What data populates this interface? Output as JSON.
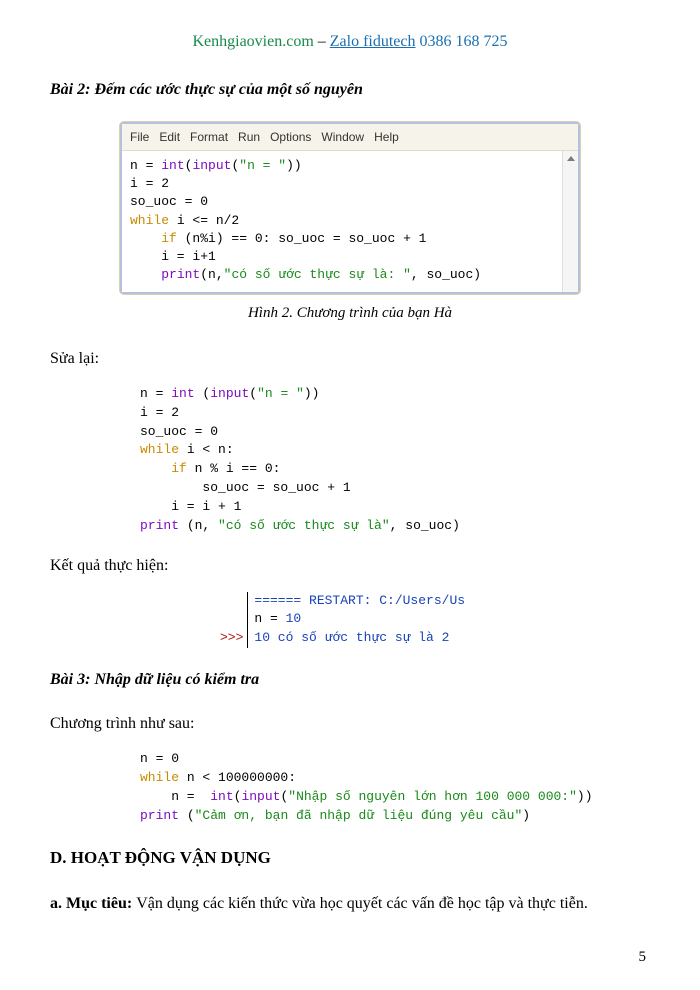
{
  "header": {
    "site": "Kenhgiaovien.com",
    "dash": " – ",
    "zalo": "Zalo fidutech",
    "phone": " 0386 168 725"
  },
  "bai2_title": "Bài 2: Đếm các ước thực sự của một số nguyên",
  "menubar": [
    "File",
    "Edit",
    "Format",
    "Run",
    "Options",
    "Window",
    "Help"
  ],
  "code1": {
    "l1a": "n = ",
    "l1b": "int",
    "l1c": "(",
    "l1d": "input",
    "l1e": "(",
    "l1f": "\"n = \"",
    "l1g": "))",
    "l2": "i = 2",
    "l3": "so_uoc = 0",
    "l4a": "while",
    "l4b": " i <= n/2",
    "l5a": "    ",
    "l5b": "if",
    "l5c": " (n%i) == 0: so_uoc = so_uoc + 1",
    "l6": "    i = i+1",
    "l7a": "    ",
    "l7b": "print",
    "l7c": "(n,",
    "l7d": "\"có số ước thực sự là: \"",
    "l7e": ", so_uoc)"
  },
  "caption2": "Hình 2. Chương trình của bạn Hà",
  "sua_lai": "Sửa lại:",
  "code2": {
    "l1a": "n = ",
    "l1b": "int",
    "l1c": " (",
    "l1d": "input",
    "l1e": "(",
    "l1f": "\"n = \"",
    "l1g": "))",
    "l2": "i = 2",
    "l3": "so_uoc = 0",
    "l4a": "while",
    "l4b": " i < n:",
    "l5a": "    ",
    "l5b": "if",
    "l5c": " n % i == 0:",
    "l6": "        so_uoc = so_uoc + 1",
    "l7": "    i = i + 1",
    "l8a": "print",
    "l8b": " (n, ",
    "l8c": "\"có số ước thực sự là\"",
    "l8d": ", so_uoc)"
  },
  "ket_qua": "Kết quả thực hiện:",
  "output": {
    "l1": "====== RESTART: C:/Users/Us",
    "l2": "n = ",
    "l2b": "10",
    "l3": "10 có số ước thực sự là 2",
    "prompt": ">>>"
  },
  "bai3_title": "Bài 3: Nhập dữ liệu có kiểm tra",
  "chuong_trinh": "Chương trình như sau:",
  "code3": {
    "l1": "n = 0",
    "l2a": "while",
    "l2b": " n < 100000000:",
    "l3a": "    n =  ",
    "l3b": "int",
    "l3c": "(",
    "l3d": "input",
    "l3e": "(",
    "l3f": "\"Nhập số nguyên lớn hơn 100 000 000:\"",
    "l3g": "))",
    "l4a": "print",
    "l4b": " (",
    "l4c": "\"Cảm ơn, bạn đã nhập dữ liệu đúng yêu cầu\"",
    "l4d": ")"
  },
  "heading_d": "D. HOẠT ĐỘNG VẬN DỤNG",
  "muc_tieu_label": "a. Mục tiêu: ",
  "muc_tieu_text": "Vận dụng các kiến thức vừa học quyết các vấn đề học tập và thực tiễn.",
  "pagenum": "5"
}
